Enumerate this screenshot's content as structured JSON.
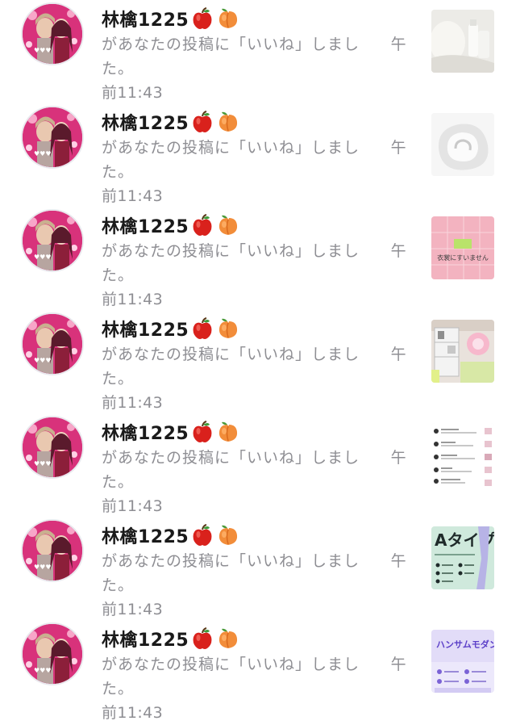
{
  "notifications": [
    {
      "username": "林檎1225",
      "emoji": [
        "apple-icon",
        "peach-icon"
      ],
      "action": "があなたの投稿に「いいね」しました。",
      "time_part1": "午",
      "time_part2": "前11:43",
      "thumbnail": "white-bottles-image"
    },
    {
      "username": "林檎1225",
      "emoji": [
        "apple-icon",
        "peach-icon"
      ],
      "action": "があなたの投稿に「いいね」しました。",
      "time_part1": "午",
      "time_part2": "前11:43",
      "thumbnail": "white-shell-image"
    },
    {
      "username": "林檎1225",
      "emoji": [
        "apple-icon",
        "peach-icon"
      ],
      "action": "があなたの投稿に「いいね」しました。",
      "time_part1": "午",
      "time_part2": "前11:43",
      "thumbnail": "pink-tiles-image",
      "thumbnail_text": "衣裳にすいません"
    },
    {
      "username": "林檎1225",
      "emoji": [
        "apple-icon",
        "peach-icon"
      ],
      "action": "があなたの投稿に「いいね」しました。",
      "time_part1": "午",
      "time_part2": "前11:43",
      "thumbnail": "room-shelf-image"
    },
    {
      "username": "林檎1225",
      "emoji": [
        "apple-icon",
        "peach-icon"
      ],
      "action": "があなたの投稿に「いいね」しました。",
      "time_part1": "午",
      "time_part2": "前11:43",
      "thumbnail": "comment-list-image"
    },
    {
      "username": "林檎1225",
      "emoji": [
        "apple-icon",
        "peach-icon"
      ],
      "action": "があなたの投稿に「いいね」しました。",
      "time_part1": "午",
      "time_part2": "前11:43",
      "thumbnail": "type-a-image",
      "thumbnail_text": "Aタイプ"
    },
    {
      "username": "林檎1225",
      "emoji": [
        "apple-icon",
        "peach-icon"
      ],
      "action": "があなたの投稿に「いいね」しました。",
      "time_part1": "午",
      "time_part2": "前11:43",
      "thumbnail": "handsome-modern-image",
      "thumbnail_text": "ハンサムモダン"
    }
  ],
  "colors": {
    "username": "#1a1a1a",
    "secondary_text": "#8e8e93",
    "avatar_pink": "#d8327b"
  }
}
